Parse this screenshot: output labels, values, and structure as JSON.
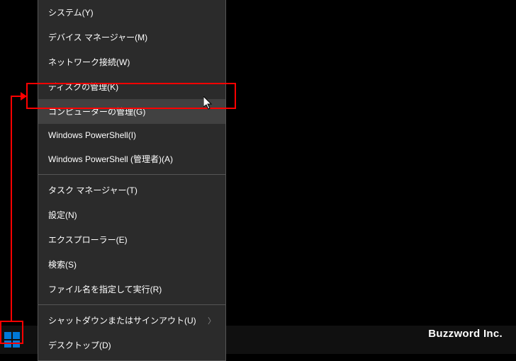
{
  "menu": {
    "items": [
      {
        "label": "システム(Y)",
        "hovered": false,
        "submenu": false
      },
      {
        "label": "デバイス マネージャー(M)",
        "hovered": false,
        "submenu": false
      },
      {
        "label": "ネットワーク接続(W)",
        "hovered": false,
        "submenu": false
      },
      {
        "label": "ディスクの管理(K)",
        "hovered": false,
        "submenu": false
      },
      {
        "label": "コンピューターの管理(G)",
        "hovered": true,
        "submenu": false
      },
      {
        "label": "Windows PowerShell(I)",
        "hovered": false,
        "submenu": false
      },
      {
        "label": "Windows PowerShell (管理者)(A)",
        "hovered": false,
        "submenu": false
      },
      {
        "label": "タスク マネージャー(T)",
        "hovered": false,
        "submenu": false,
        "sep_before": true
      },
      {
        "label": "設定(N)",
        "hovered": false,
        "submenu": false
      },
      {
        "label": "エクスプローラー(E)",
        "hovered": false,
        "submenu": false
      },
      {
        "label": "検索(S)",
        "hovered": false,
        "submenu": false
      },
      {
        "label": "ファイル名を指定して実行(R)",
        "hovered": false,
        "submenu": false
      },
      {
        "label": "シャットダウンまたはサインアウト(U)",
        "hovered": false,
        "submenu": true,
        "sep_before": true
      },
      {
        "label": "デスクトップ(D)",
        "hovered": false,
        "submenu": false
      }
    ]
  },
  "watermark": "Buzzword Inc."
}
